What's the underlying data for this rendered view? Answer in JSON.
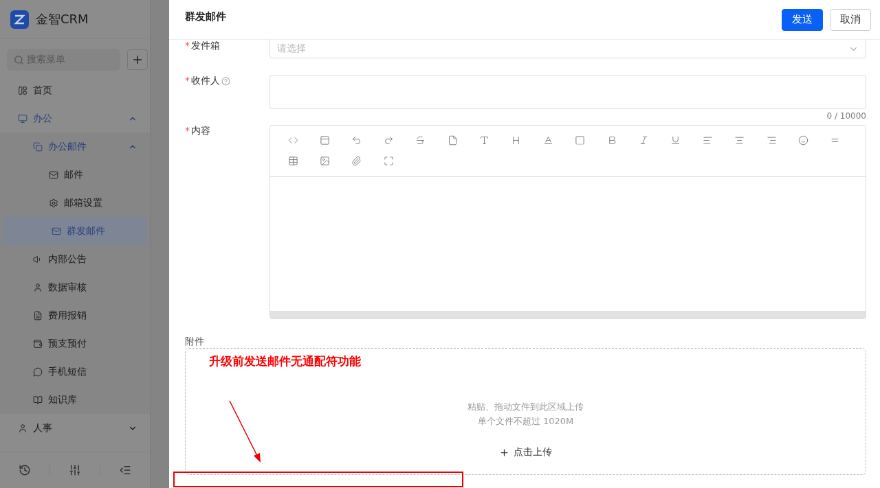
{
  "app": {
    "logo_text": "金智CRM"
  },
  "sidebar": {
    "search_placeholder": "搜索菜单",
    "items": [
      {
        "label": "首页",
        "selected": false
      },
      {
        "label": "办公",
        "selected": false,
        "expanded": true,
        "children": [
          {
            "label": "办公邮件",
            "selected": false,
            "expanded": true,
            "children": [
              {
                "label": "邮件",
                "selected": false
              },
              {
                "label": "邮箱设置",
                "selected": false
              },
              {
                "label": "群发邮件",
                "selected": true
              }
            ]
          },
          {
            "label": "内部公告",
            "selected": false
          },
          {
            "label": "数据审核",
            "selected": false
          },
          {
            "label": "费用报销",
            "selected": false
          },
          {
            "label": "预支预付",
            "selected": false
          },
          {
            "label": "手机短信",
            "selected": false
          },
          {
            "label": "知识库",
            "selected": false
          }
        ]
      },
      {
        "label": "人事",
        "selected": false,
        "expanded": false
      }
    ]
  },
  "drawer": {
    "title": "群发邮件",
    "buttons": [
      {
        "label": "发送",
        "kind": "primary"
      },
      {
        "label": "取消",
        "kind": "default"
      }
    ],
    "form": {
      "sender": {
        "label": "发件箱",
        "required_mark": "*",
        "placeholder": "请选择"
      },
      "recipients": {
        "label": "收件人",
        "required_mark": "*",
        "counter": "0 / 10000"
      },
      "content": {
        "label": "内容",
        "required_mark": "*"
      },
      "attachments": {
        "label": "附件",
        "hint": "粘贴、拖动文件到此区域上传",
        "limit": "单个文件不超过 1020M",
        "upload": "点击上传"
      }
    }
  },
  "annotation": {
    "text": "升级前发送邮件无通配符功能"
  }
}
